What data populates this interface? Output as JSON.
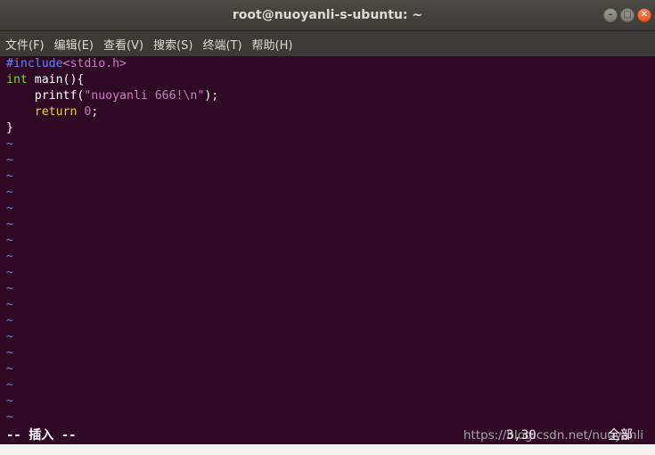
{
  "window": {
    "title": "root@nuoyanli-s-ubuntu: ~",
    "buttons": {
      "minimize": "–",
      "maximize": "□",
      "close": "✕"
    }
  },
  "menubar": {
    "items": [
      "文件(F)",
      "编辑(E)",
      "查看(V)",
      "搜索(S)",
      "终端(T)",
      "帮助(H)"
    ]
  },
  "editor": {
    "code": {
      "l1_kw": "#include",
      "l1_hdr": "<stdio.h>",
      "l2_type": "int",
      "l2_rest": " main(){",
      "l3_indent": "    printf(",
      "l3_str": "\"nuoyanli 666!\\n\"",
      "l3_end": ");",
      "l4_indent": "    ",
      "l4_kw": "return",
      "l4_sp": " ",
      "l4_num": "0",
      "l4_end": ";",
      "l5": "}"
    },
    "empty_marker": "~",
    "empty_line_count": 18
  },
  "status": {
    "mode": "-- 插入 --",
    "position": "3,30",
    "scroll": "全部"
  },
  "watermark": "https://blog.csdn.net/nuoyanli",
  "colors": {
    "terminal_bg": "#300a24",
    "include": "#6b7ff2",
    "string": "#c77fc6",
    "type": "#78d23c",
    "return": "#e8d04a"
  }
}
